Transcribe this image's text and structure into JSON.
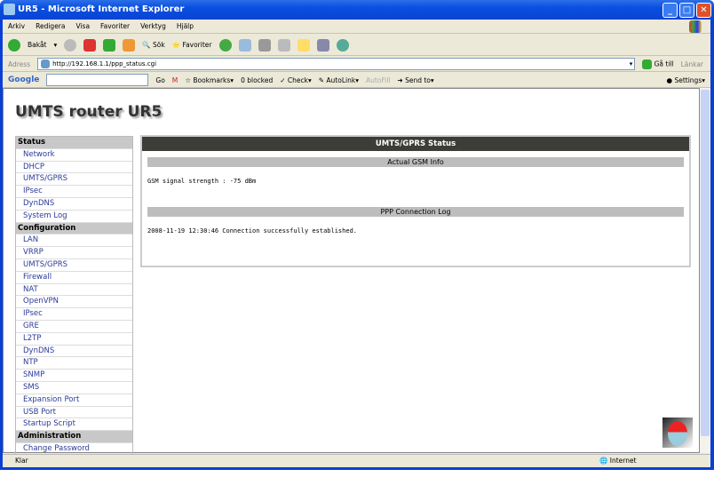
{
  "window": {
    "title": "UR5 - Microsoft Internet Explorer"
  },
  "menu": [
    "Arkiv",
    "Redigera",
    "Visa",
    "Favoriter",
    "Verktyg",
    "Hjälp"
  ],
  "toolbar": {
    "back": "Bakåt",
    "search": "Sök",
    "favorites": "Favoriter"
  },
  "address": {
    "label": "Adress",
    "url": "http://192.168.1.1/ppp_status.cgi",
    "go": "Gå till",
    "links": "Länkar"
  },
  "google": {
    "brand": "Google",
    "go": "Go",
    "bookmarks": "Bookmarks",
    "blocked": "0 blocked",
    "check": "Check",
    "autolink": "AutoLink",
    "autofill": "AutoFill",
    "sendto": "Send to",
    "settings": "Settings"
  },
  "statusbar": {
    "left": "Klar",
    "zone": "Internet"
  },
  "page": {
    "title": "UMTS router UR5",
    "sidebar": [
      {
        "group": "Status",
        "items": [
          "Network",
          "DHCP",
          "UMTS/GPRS",
          "IPsec",
          "DynDNS",
          "System Log"
        ]
      },
      {
        "group": "Configuration",
        "items": [
          "LAN",
          "VRRP",
          "UMTS/GPRS",
          "Firewall",
          "NAT",
          "OpenVPN",
          "IPsec",
          "GRE",
          "L2TP",
          "DynDNS",
          "NTP",
          "SNMP",
          "SMS",
          "Expansion Port",
          "USB Port",
          "Startup Script"
        ]
      },
      {
        "group": "Administration",
        "items": [
          "Change Password"
        ]
      }
    ],
    "panel": {
      "title": "UMTS/GPRS Status",
      "gsm_header": "Actual GSM Info",
      "gsm_text": "GSM signal strength : -75 dBm",
      "log_header": "PPP Connection Log",
      "log_text": "2008-11-19 12:30:46 Connection successfully established."
    }
  }
}
